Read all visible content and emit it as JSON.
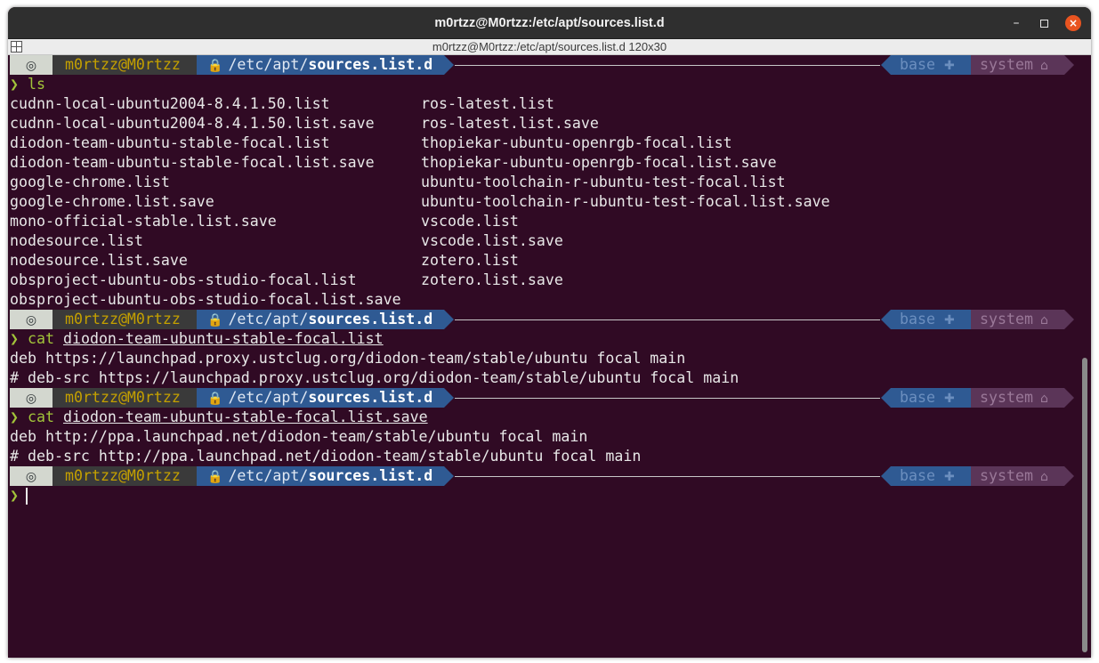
{
  "window": {
    "title": "m0rtzz@M0rtzz:/etc/apt/sources.list.d",
    "tab_title": "m0rtzz@M0rtzz:/etc/apt/sources.list.d 120x30",
    "controls": {
      "minimize": "–",
      "close": "×"
    }
  },
  "prompt": {
    "os_icon": "ubuntu-icon",
    "context": "m0rtzz@M0rtzz",
    "lock_icon": "🔒",
    "dir_prefix": "/etc/apt/",
    "dir_name": "sources.list.d",
    "env": "base",
    "env_icon": "✚",
    "system": "system",
    "system_icon": "⌂",
    "chevron": "❯"
  },
  "blocks": [
    {
      "command": "ls",
      "argument": "",
      "ls_left": [
        "cudnn-local-ubuntu2004-8.4.1.50.list",
        "cudnn-local-ubuntu2004-8.4.1.50.list.save",
        "diodon-team-ubuntu-stable-focal.list",
        "diodon-team-ubuntu-stable-focal.list.save",
        "google-chrome.list",
        "google-chrome.list.save",
        "mono-official-stable.list.save",
        "nodesource.list",
        "nodesource.list.save",
        "obsproject-ubuntu-obs-studio-focal.list",
        "obsproject-ubuntu-obs-studio-focal.list.save"
      ],
      "ls_right": [
        "ros-latest.list",
        "ros-latest.list.save",
        "thopiekar-ubuntu-openrgb-focal.list",
        "thopiekar-ubuntu-openrgb-focal.list.save",
        "ubuntu-toolchain-r-ubuntu-test-focal.list",
        "ubuntu-toolchain-r-ubuntu-test-focal.list.save",
        "vscode.list",
        "vscode.list.save",
        "zotero.list",
        "zotero.list.save",
        ""
      ]
    },
    {
      "command": "cat",
      "argument": "diodon-team-ubuntu-stable-focal.list",
      "output": [
        "deb https://launchpad.proxy.ustclug.org/diodon-team/stable/ubuntu focal main",
        "# deb-src https://launchpad.proxy.ustclug.org/diodon-team/stable/ubuntu focal main"
      ]
    },
    {
      "command": "cat",
      "argument": "diodon-team-ubuntu-stable-focal.list.save",
      "output": [
        "deb http://ppa.launchpad.net/diodon-team/stable/ubuntu focal main",
        "# deb-src http://ppa.launchpad.net/diodon-team/stable/ubuntu focal main"
      ]
    }
  ],
  "colors": {
    "background": "#300a24",
    "prompt_green": "#a2c43a",
    "dir_segment": "#2f5a93",
    "context_text": "#c4a000"
  }
}
